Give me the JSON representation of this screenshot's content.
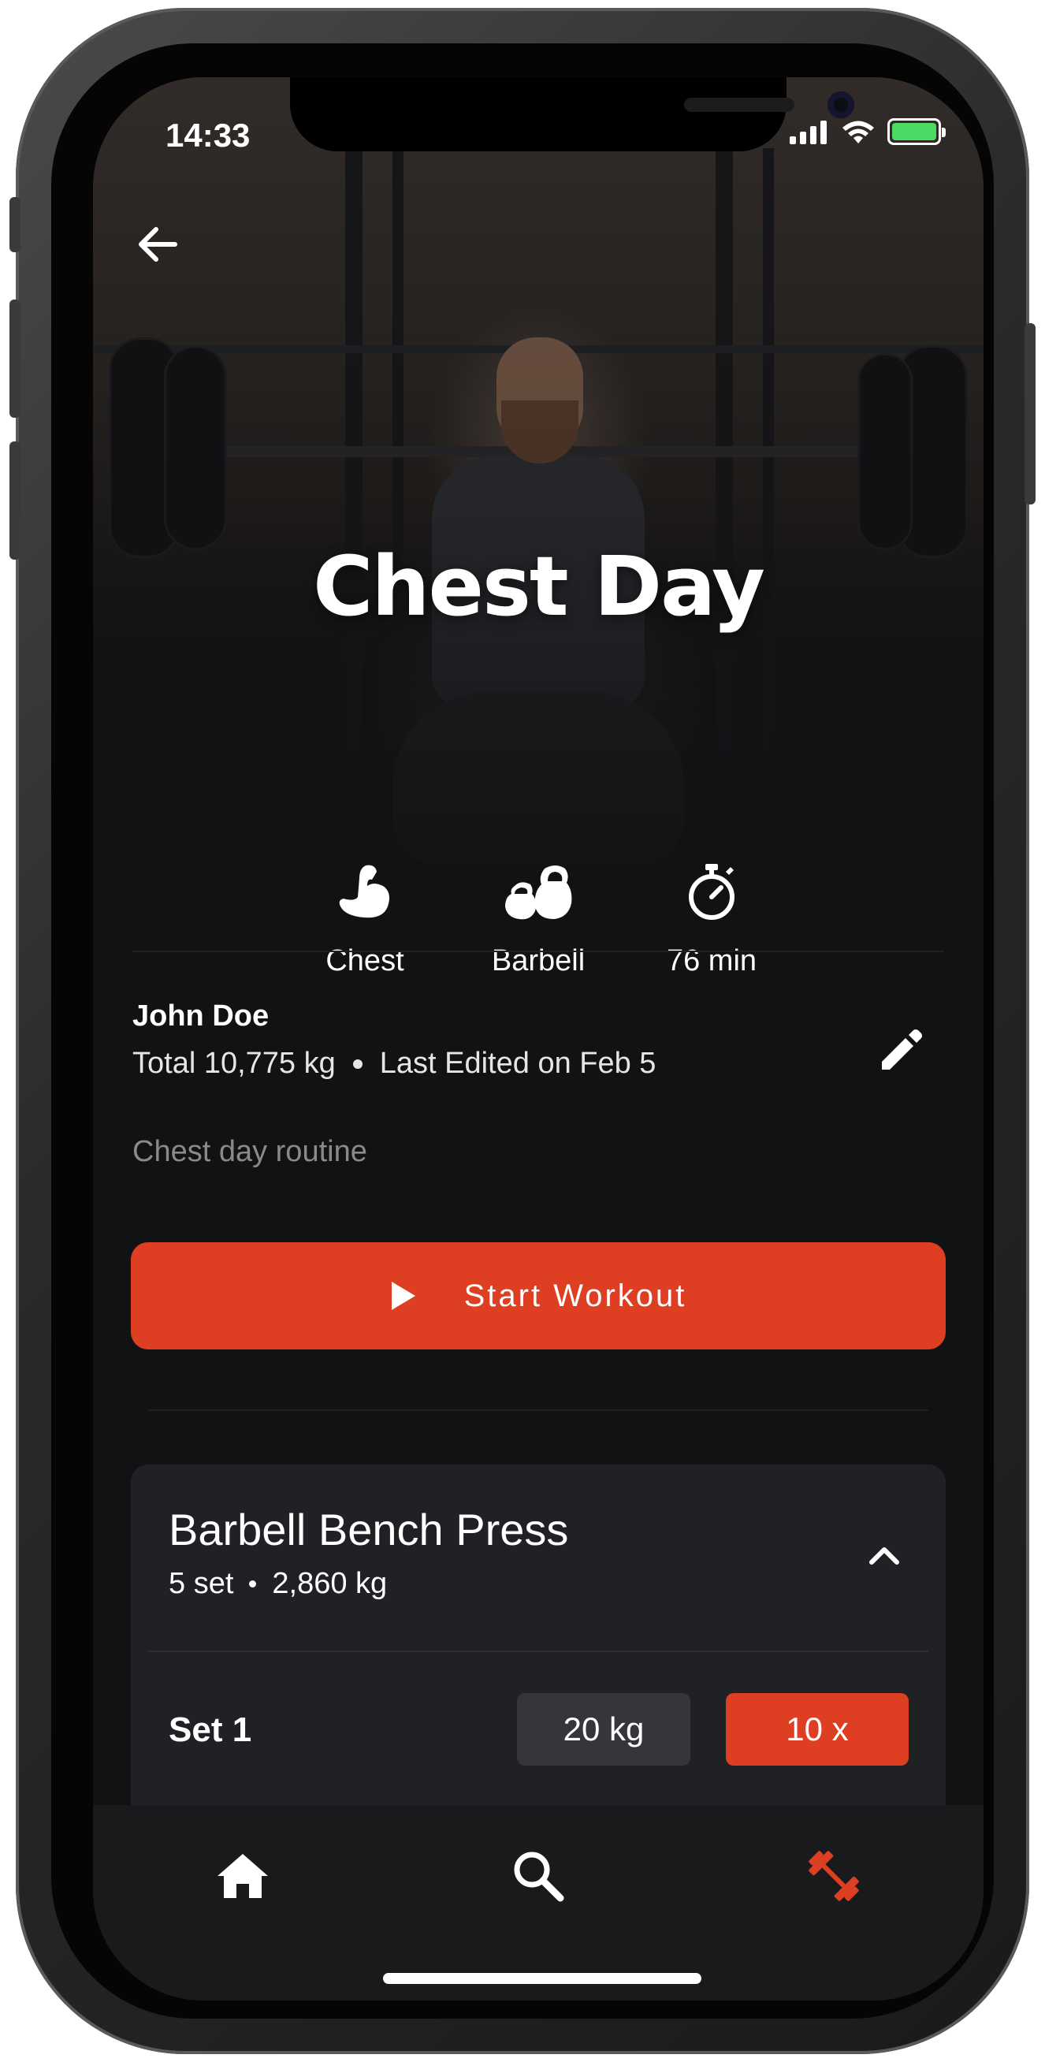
{
  "status_bar": {
    "time": "14:33"
  },
  "workout": {
    "title": "Chest Day",
    "stats": [
      {
        "icon": "flexed-bicep-icon",
        "label": "Chest"
      },
      {
        "icon": "kettlebells-icon",
        "label": "Barbell"
      },
      {
        "icon": "stopwatch-icon",
        "label": "76 min"
      }
    ],
    "author": "John Doe",
    "total": "Total 10,775 kg",
    "last_edited": "Last Edited on Feb 5",
    "description": "Chest day routine",
    "start_label": "Start Workout"
  },
  "exercise": {
    "name": "Barbell Bench Press",
    "sets": "5 set",
    "volume": "2,860 kg",
    "set_rows": [
      {
        "label": "Set 1",
        "weight": "20 kg",
        "reps": "10 x"
      }
    ]
  },
  "tabbar": {
    "items": [
      {
        "icon": "home-icon",
        "active": false
      },
      {
        "icon": "search-icon",
        "active": false
      },
      {
        "icon": "dumbbell-icon",
        "active": true
      }
    ]
  },
  "colors": {
    "accent": "#de3f22",
    "background": "#111214",
    "card": "#202124",
    "muted_text": "#8a8a8d"
  }
}
